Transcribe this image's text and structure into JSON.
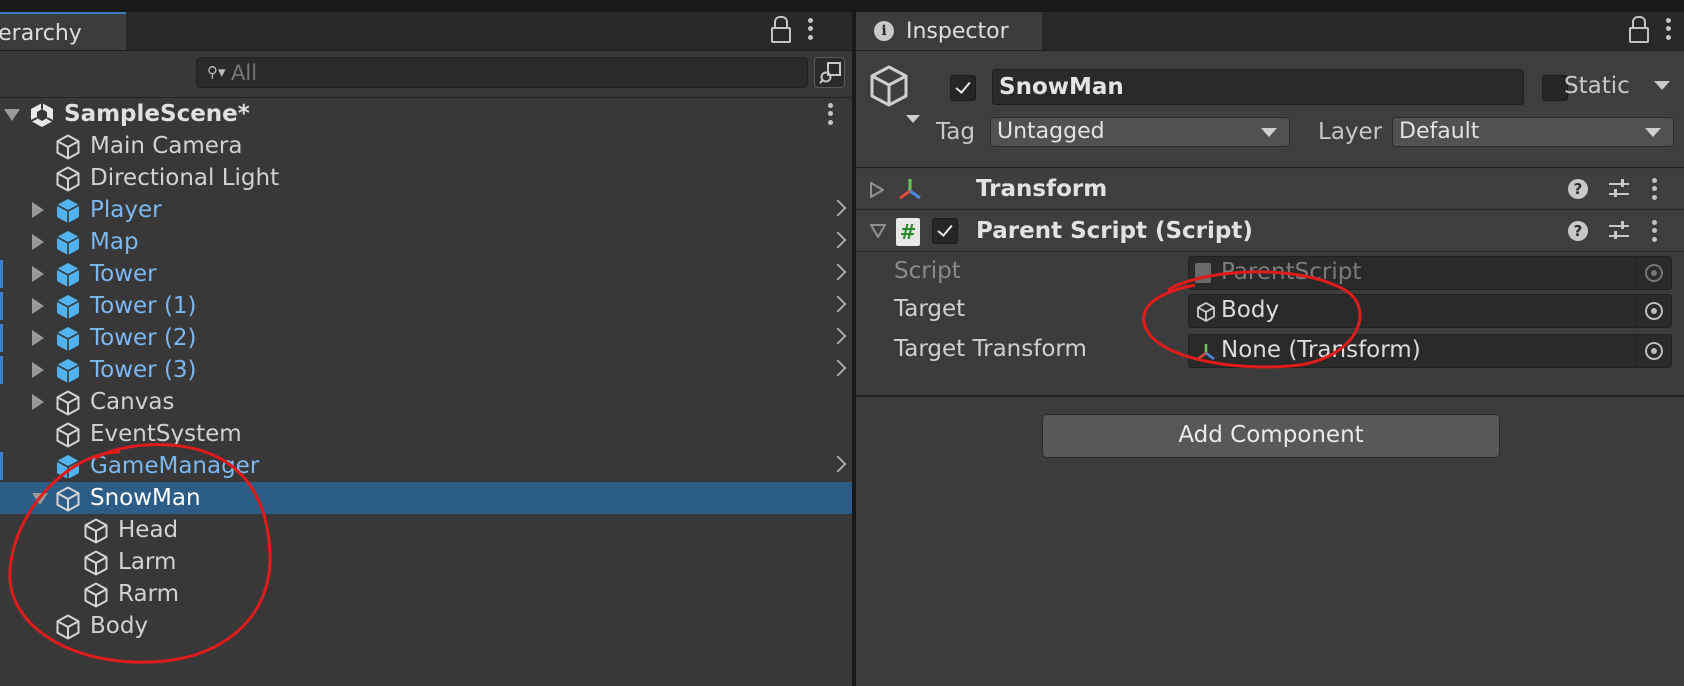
{
  "hierarchy": {
    "tab_label": "ierarchy",
    "search_placeholder": "All",
    "scene_name": "SampleScene*",
    "items": [
      {
        "label": "Main Camera"
      },
      {
        "label": "Directional Light"
      },
      {
        "label": "Player"
      },
      {
        "label": "Map"
      },
      {
        "label": "Tower"
      },
      {
        "label": "Tower (1)"
      },
      {
        "label": "Tower (2)"
      },
      {
        "label": "Tower (3)"
      },
      {
        "label": "Canvas"
      },
      {
        "label": "EventSystem"
      },
      {
        "label": "GameManager"
      },
      {
        "label": "SnowMan"
      },
      {
        "label": "Head"
      },
      {
        "label": "Larm"
      },
      {
        "label": "Rarm"
      },
      {
        "label": "Body"
      }
    ]
  },
  "inspector": {
    "tab_label": "Inspector",
    "object_name": "SnowMan",
    "active": true,
    "static_label": "Static",
    "tag_label": "Tag",
    "tag_value": "Untagged",
    "layer_label": "Layer",
    "layer_value": "Default",
    "components": [
      {
        "title": "Transform"
      },
      {
        "title": "Parent Script (Script)"
      }
    ],
    "properties": [
      {
        "label": "Script",
        "value": "ParentScript"
      },
      {
        "label": "Target",
        "value": "Body"
      },
      {
        "label": "Target Transform",
        "value": "None (Transform)"
      }
    ],
    "add_component_label": "Add Component"
  },
  "colors": {
    "selection": "#2c5d87",
    "prefab_text": "#7cb8f0",
    "annotation": "#e01b1b"
  }
}
